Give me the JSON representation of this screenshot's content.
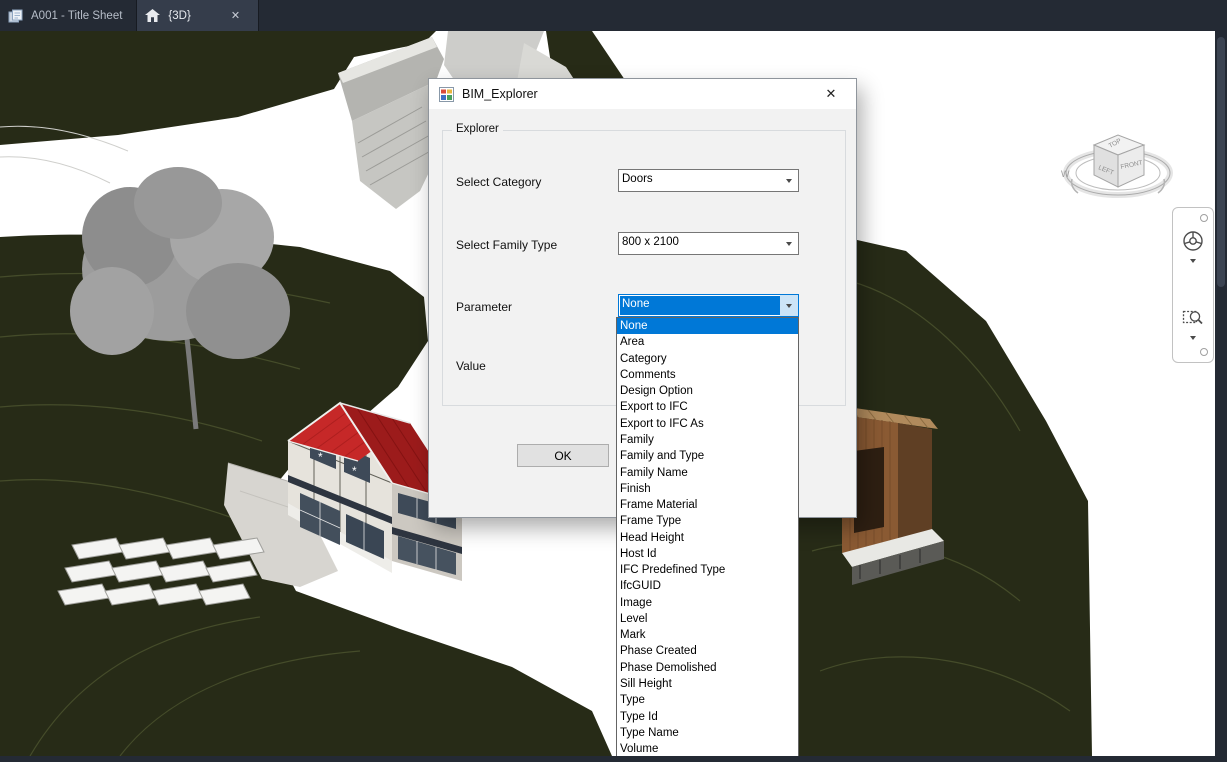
{
  "window": {
    "tabs": [
      {
        "label": "A001 - Title Sheet"
      },
      {
        "label": "{3D}"
      }
    ],
    "tab_close": "✕"
  },
  "dialog": {
    "title": "BIM_Explorer",
    "close": "✕",
    "group_title": "Explorer",
    "fields": [
      {
        "label": "Select Category",
        "value": "Doors"
      },
      {
        "label": "Select Family Type",
        "value": "800 x 2100"
      },
      {
        "label": "Parameter",
        "value": "None"
      },
      {
        "label": "Value",
        "value": ""
      }
    ],
    "ok_label": "OK"
  },
  "dropdown": {
    "selected": "None",
    "items": [
      "None",
      "Area",
      "Category",
      "Comments",
      "Design Option",
      "Export to IFC",
      "Export to IFC As",
      "Family",
      "Family and Type",
      "Family Name",
      "Finish",
      "Frame Material",
      "Frame Type",
      "Head Height",
      "Host Id",
      "IFC Predefined Type",
      "IfcGUID",
      "Image",
      "Level",
      "Mark",
      "Phase Created",
      "Phase Demolished",
      "Sill Height",
      "Type",
      "Type Id",
      "Type Name",
      "Volume"
    ]
  },
  "viewcube": {
    "top": "TOP",
    "left": "LEFT",
    "front": "FRONT",
    "west": "W"
  },
  "colors": {
    "terrain": "#272b17",
    "selection_blue": "#0078d7",
    "roof_red": "#c62828",
    "tabbar_dark": "#242a34"
  }
}
